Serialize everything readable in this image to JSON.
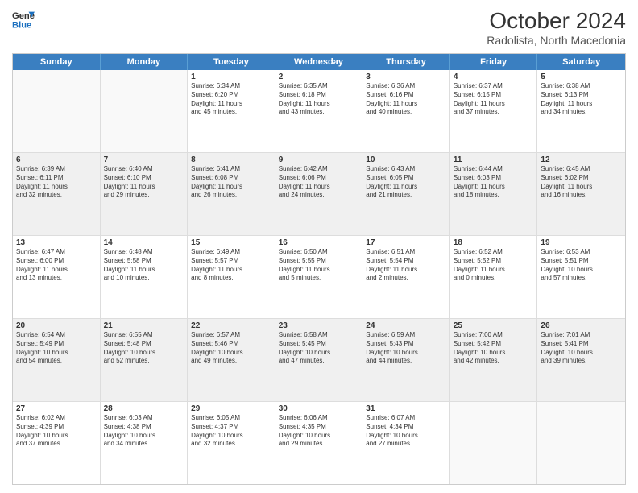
{
  "header": {
    "logo_line1": "General",
    "logo_line2": "Blue",
    "month": "October 2024",
    "location": "Radolista, North Macedonia"
  },
  "days": [
    "Sunday",
    "Monday",
    "Tuesday",
    "Wednesday",
    "Thursday",
    "Friday",
    "Saturday"
  ],
  "rows": [
    [
      {
        "day": "",
        "lines": [],
        "empty": true
      },
      {
        "day": "",
        "lines": [],
        "empty": true
      },
      {
        "day": "1",
        "lines": [
          "Sunrise: 6:34 AM",
          "Sunset: 6:20 PM",
          "Daylight: 11 hours",
          "and 45 minutes."
        ]
      },
      {
        "day": "2",
        "lines": [
          "Sunrise: 6:35 AM",
          "Sunset: 6:18 PM",
          "Daylight: 11 hours",
          "and 43 minutes."
        ]
      },
      {
        "day": "3",
        "lines": [
          "Sunrise: 6:36 AM",
          "Sunset: 6:16 PM",
          "Daylight: 11 hours",
          "and 40 minutes."
        ]
      },
      {
        "day": "4",
        "lines": [
          "Sunrise: 6:37 AM",
          "Sunset: 6:15 PM",
          "Daylight: 11 hours",
          "and 37 minutes."
        ]
      },
      {
        "day": "5",
        "lines": [
          "Sunrise: 6:38 AM",
          "Sunset: 6:13 PM",
          "Daylight: 11 hours",
          "and 34 minutes."
        ]
      }
    ],
    [
      {
        "day": "6",
        "lines": [
          "Sunrise: 6:39 AM",
          "Sunset: 6:11 PM",
          "Daylight: 11 hours",
          "and 32 minutes."
        ],
        "shaded": true
      },
      {
        "day": "7",
        "lines": [
          "Sunrise: 6:40 AM",
          "Sunset: 6:10 PM",
          "Daylight: 11 hours",
          "and 29 minutes."
        ],
        "shaded": true
      },
      {
        "day": "8",
        "lines": [
          "Sunrise: 6:41 AM",
          "Sunset: 6:08 PM",
          "Daylight: 11 hours",
          "and 26 minutes."
        ],
        "shaded": true
      },
      {
        "day": "9",
        "lines": [
          "Sunrise: 6:42 AM",
          "Sunset: 6:06 PM",
          "Daylight: 11 hours",
          "and 24 minutes."
        ],
        "shaded": true
      },
      {
        "day": "10",
        "lines": [
          "Sunrise: 6:43 AM",
          "Sunset: 6:05 PM",
          "Daylight: 11 hours",
          "and 21 minutes."
        ],
        "shaded": true
      },
      {
        "day": "11",
        "lines": [
          "Sunrise: 6:44 AM",
          "Sunset: 6:03 PM",
          "Daylight: 11 hours",
          "and 18 minutes."
        ],
        "shaded": true
      },
      {
        "day": "12",
        "lines": [
          "Sunrise: 6:45 AM",
          "Sunset: 6:02 PM",
          "Daylight: 11 hours",
          "and 16 minutes."
        ],
        "shaded": true
      }
    ],
    [
      {
        "day": "13",
        "lines": [
          "Sunrise: 6:47 AM",
          "Sunset: 6:00 PM",
          "Daylight: 11 hours",
          "and 13 minutes."
        ]
      },
      {
        "day": "14",
        "lines": [
          "Sunrise: 6:48 AM",
          "Sunset: 5:58 PM",
          "Daylight: 11 hours",
          "and 10 minutes."
        ]
      },
      {
        "day": "15",
        "lines": [
          "Sunrise: 6:49 AM",
          "Sunset: 5:57 PM",
          "Daylight: 11 hours",
          "and 8 minutes."
        ]
      },
      {
        "day": "16",
        "lines": [
          "Sunrise: 6:50 AM",
          "Sunset: 5:55 PM",
          "Daylight: 11 hours",
          "and 5 minutes."
        ]
      },
      {
        "day": "17",
        "lines": [
          "Sunrise: 6:51 AM",
          "Sunset: 5:54 PM",
          "Daylight: 11 hours",
          "and 2 minutes."
        ]
      },
      {
        "day": "18",
        "lines": [
          "Sunrise: 6:52 AM",
          "Sunset: 5:52 PM",
          "Daylight: 11 hours",
          "and 0 minutes."
        ]
      },
      {
        "day": "19",
        "lines": [
          "Sunrise: 6:53 AM",
          "Sunset: 5:51 PM",
          "Daylight: 10 hours",
          "and 57 minutes."
        ]
      }
    ],
    [
      {
        "day": "20",
        "lines": [
          "Sunrise: 6:54 AM",
          "Sunset: 5:49 PM",
          "Daylight: 10 hours",
          "and 54 minutes."
        ],
        "shaded": true
      },
      {
        "day": "21",
        "lines": [
          "Sunrise: 6:55 AM",
          "Sunset: 5:48 PM",
          "Daylight: 10 hours",
          "and 52 minutes."
        ],
        "shaded": true
      },
      {
        "day": "22",
        "lines": [
          "Sunrise: 6:57 AM",
          "Sunset: 5:46 PM",
          "Daylight: 10 hours",
          "and 49 minutes."
        ],
        "shaded": true
      },
      {
        "day": "23",
        "lines": [
          "Sunrise: 6:58 AM",
          "Sunset: 5:45 PM",
          "Daylight: 10 hours",
          "and 47 minutes."
        ],
        "shaded": true
      },
      {
        "day": "24",
        "lines": [
          "Sunrise: 6:59 AM",
          "Sunset: 5:43 PM",
          "Daylight: 10 hours",
          "and 44 minutes."
        ],
        "shaded": true
      },
      {
        "day": "25",
        "lines": [
          "Sunrise: 7:00 AM",
          "Sunset: 5:42 PM",
          "Daylight: 10 hours",
          "and 42 minutes."
        ],
        "shaded": true
      },
      {
        "day": "26",
        "lines": [
          "Sunrise: 7:01 AM",
          "Sunset: 5:41 PM",
          "Daylight: 10 hours",
          "and 39 minutes."
        ],
        "shaded": true
      }
    ],
    [
      {
        "day": "27",
        "lines": [
          "Sunrise: 6:02 AM",
          "Sunset: 4:39 PM",
          "Daylight: 10 hours",
          "and 37 minutes."
        ]
      },
      {
        "day": "28",
        "lines": [
          "Sunrise: 6:03 AM",
          "Sunset: 4:38 PM",
          "Daylight: 10 hours",
          "and 34 minutes."
        ]
      },
      {
        "day": "29",
        "lines": [
          "Sunrise: 6:05 AM",
          "Sunset: 4:37 PM",
          "Daylight: 10 hours",
          "and 32 minutes."
        ]
      },
      {
        "day": "30",
        "lines": [
          "Sunrise: 6:06 AM",
          "Sunset: 4:35 PM",
          "Daylight: 10 hours",
          "and 29 minutes."
        ]
      },
      {
        "day": "31",
        "lines": [
          "Sunrise: 6:07 AM",
          "Sunset: 4:34 PM",
          "Daylight: 10 hours",
          "and 27 minutes."
        ]
      },
      {
        "day": "",
        "lines": [],
        "empty": true
      },
      {
        "day": "",
        "lines": [],
        "empty": true
      }
    ]
  ]
}
